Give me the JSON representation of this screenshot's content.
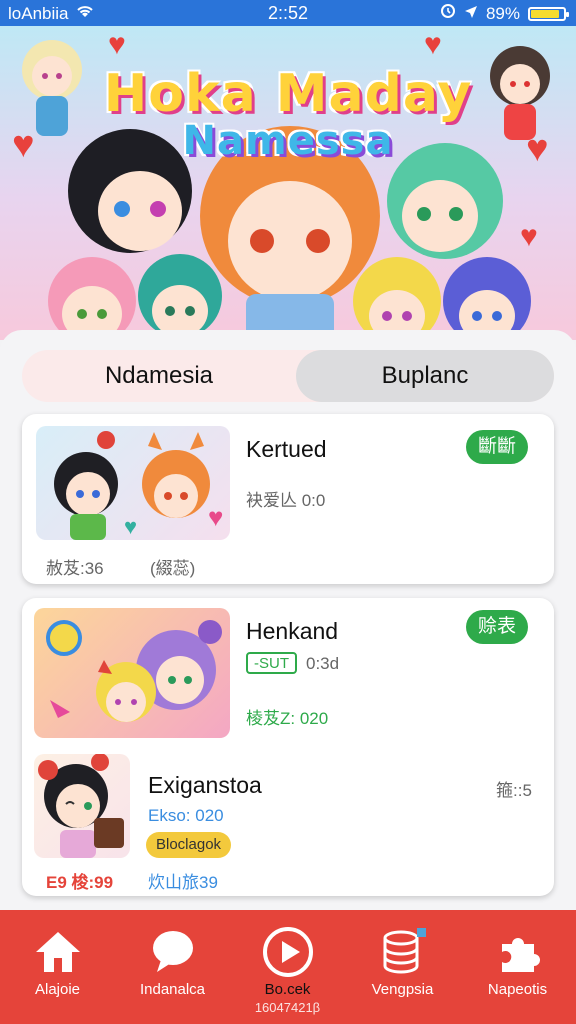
{
  "status_bar": {
    "carrier": "loAnbiia",
    "time": "2::52",
    "battery": "89%",
    "battery_level": 0.89
  },
  "banner": {
    "title_line1": "Hoka Maday",
    "title_line2": "Namessa"
  },
  "tabs": {
    "left": "Ndamesia",
    "right": "Buplanc",
    "selected": "right"
  },
  "cards": [
    {
      "title": "Kertued",
      "badge": "斷斷",
      "meta1": "袂爱亾 0:0",
      "footer_left": "赦芨:36",
      "footer_right": "(綴蕊)"
    },
    {
      "title": "Henkand",
      "badge": "赊表",
      "tag": "-SUT",
      "tag_time": "0:3d",
      "meta2": "棱芨Z: 020"
    },
    {
      "title": "Exiganstoa",
      "right_meta": "箍::5",
      "meta1": "Ekso: 020",
      "pill": "Bloclagok",
      "footer_left": "E9 梭:99",
      "footer_right": "炊山旅39"
    }
  ],
  "bottom_nav": {
    "items": [
      {
        "label": "Alajoie",
        "icon": "home-icon"
      },
      {
        "label": "Indanalca",
        "icon": "chat-bubble-icon"
      },
      {
        "label": "Bo.cek",
        "icon": "play-icon",
        "sub": "16047421β"
      },
      {
        "label": "Vengpsia",
        "icon": "database-icon"
      },
      {
        "label": "Napeotis",
        "icon": "puzzle-icon"
      }
    ]
  },
  "colors": {
    "status_bar": "#2a74d9",
    "bottom_nav": "#e5443a",
    "green_badge": "#2eaa4a",
    "yellow_pill": "#f3c93c"
  }
}
